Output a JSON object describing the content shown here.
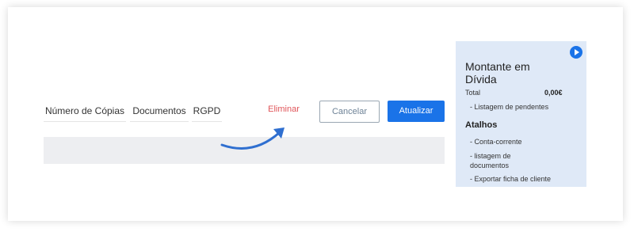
{
  "tabs": [
    "Número de Cópias",
    "Documentos",
    "RGPD"
  ],
  "actions": {
    "delete_label": "Eliminar",
    "cancel_label": "Cancelar",
    "update_label": "Atualizar"
  },
  "sidebar": {
    "title": "Montante em Dívida",
    "total_label": "Total",
    "total_value": "0,00€",
    "pending_link": "- Listagem de pendentes",
    "shortcuts_title": "Atalhos",
    "shortcuts": [
      "- Conta-corrente",
      "- listagem de documentos",
      "- Exportar ficha de cliente"
    ]
  },
  "icons": {
    "play": "play-icon",
    "arrow": "curved-arrow-icon"
  },
  "colors": {
    "accent": "#1a73e8",
    "danger": "#e0555a",
    "sidebar_bg": "#dfe9f7"
  }
}
